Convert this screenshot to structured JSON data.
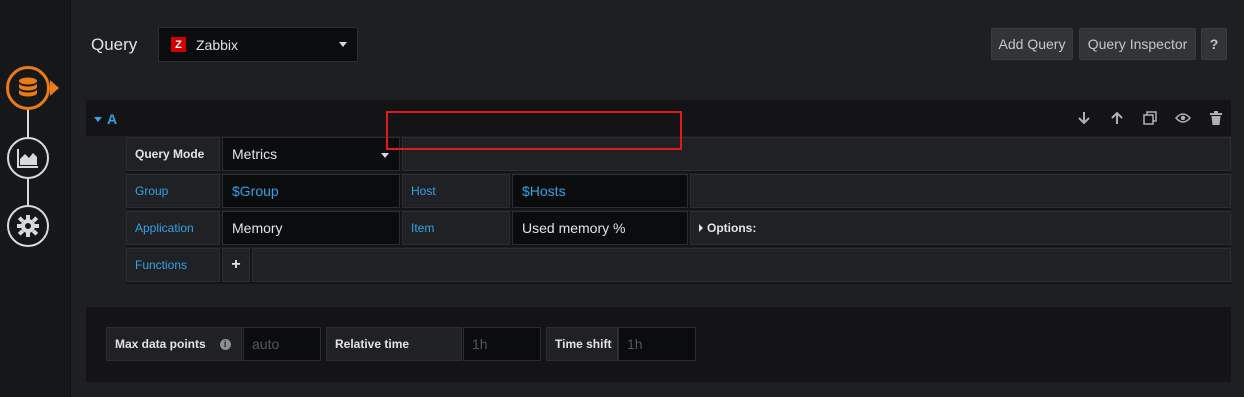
{
  "header": {
    "title": "Query",
    "datasource": {
      "name": "Zabbix",
      "logo_letter": "Z"
    },
    "buttons": {
      "add_query": "Add Query",
      "query_inspector": "Query Inspector",
      "help": "?"
    }
  },
  "query": {
    "ref_id": "A",
    "query_mode_label": "Query Mode",
    "query_mode_value": "Metrics",
    "group_label": "Group",
    "group_value": "$Group",
    "host_label": "Host",
    "host_value": "$Hosts",
    "application_label": "Application",
    "application_value": "Memory",
    "item_label": "Item",
    "item_value": "Used memory %",
    "options_label": "Options:",
    "functions_label": "Functions",
    "add_function": "+"
  },
  "options": {
    "max_data_points_label": "Max data points",
    "max_data_points_placeholder": "auto",
    "relative_time_label": "Relative time",
    "relative_time_placeholder": "1h",
    "time_shift_label": "Time shift",
    "time_shift_placeholder": "1h"
  },
  "colors": {
    "accent": "#eb7b18",
    "link": "#33a2e5",
    "highlight": "#e0191d",
    "zabbix": "#d40000"
  }
}
